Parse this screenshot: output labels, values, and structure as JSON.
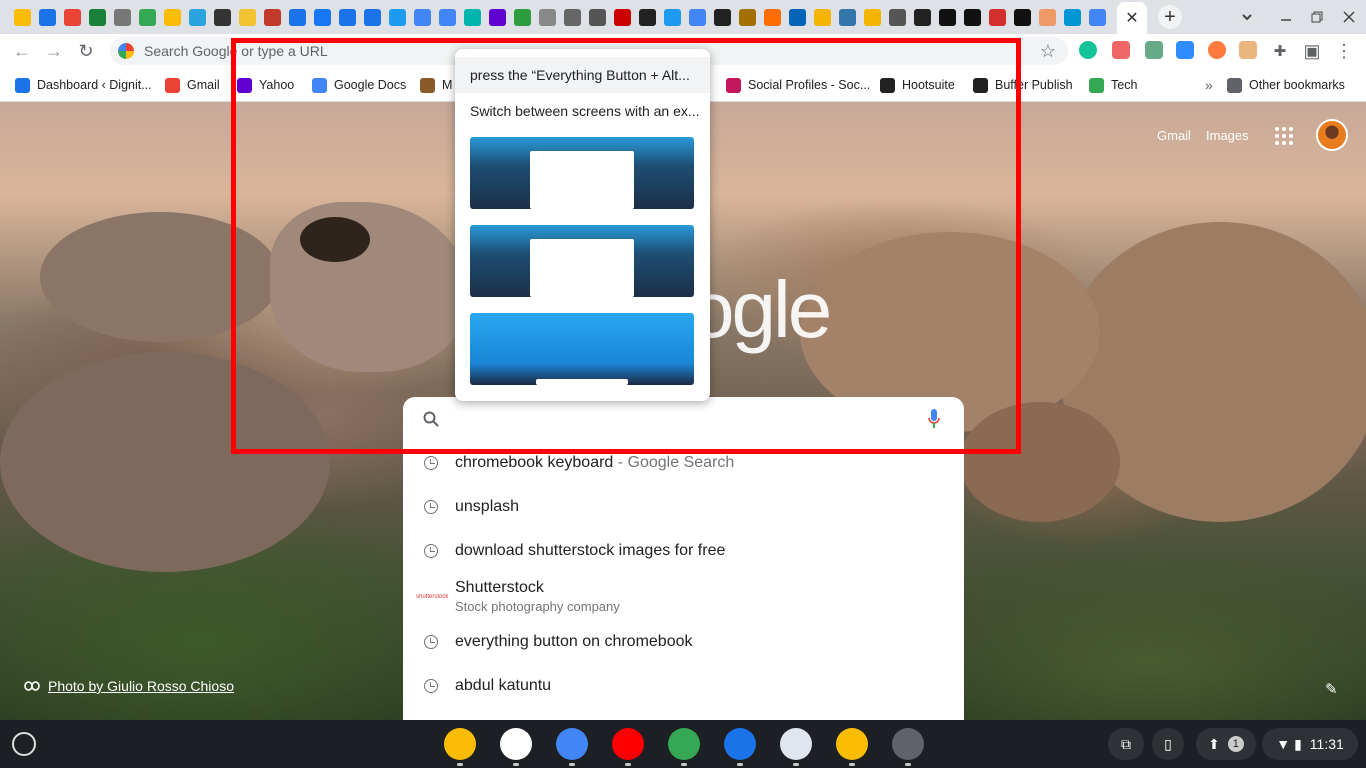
{
  "tabs": {
    "active_close": "✕",
    "new_tab": "+",
    "icons": [
      {
        "name": "chromeos-tab-icon",
        "color": "#fbbc05"
      },
      {
        "name": "docs-tab-icon",
        "color": "#1a73e8"
      },
      {
        "name": "gmail-tab-icon",
        "color": "#ea4335"
      },
      {
        "name": "sheets-tab-icon",
        "color": "#188038"
      },
      {
        "name": "cart-tab-icon",
        "color": "#777"
      },
      {
        "name": "tab-2-icon",
        "color": "#34a853"
      },
      {
        "name": "drive-tab-icon",
        "color": "#fbbc05"
      },
      {
        "name": "telegram-tab-icon",
        "color": "#2aa3df"
      },
      {
        "name": "tab-icon-9",
        "color": "#333"
      },
      {
        "name": "tab-icon-10",
        "color": "#f1c232"
      },
      {
        "name": "tab-icon-11",
        "color": "#c0392b"
      },
      {
        "name": "docs-tab-icon-2",
        "color": "#1a73e8"
      },
      {
        "name": "facebook-tab-icon",
        "color": "#1877f2"
      },
      {
        "name": "tab-icon-14",
        "color": "#1a73e8"
      },
      {
        "name": "tab-icon-15",
        "color": "#1a73e8"
      },
      {
        "name": "twitter-tab-icon",
        "color": "#1d9bf0"
      },
      {
        "name": "docs-tab-icon-3",
        "color": "#4285f4"
      },
      {
        "name": "docs-tab-icon-4",
        "color": "#4285f4"
      },
      {
        "name": "tab-icon-19",
        "color": "#00b5ad"
      },
      {
        "name": "yahoo-mail-tab-icon",
        "color": "#6001d2"
      },
      {
        "name": "px-tab-icon",
        "color": "#2e9d3e"
      },
      {
        "name": "tab-icon-22",
        "color": "#888"
      },
      {
        "name": "tab-icon-23",
        "color": "#666"
      },
      {
        "name": "tab-icon-24",
        "color": "#555"
      },
      {
        "name": "help-tab-icon",
        "color": "#c00"
      },
      {
        "name": "h-tab-icon",
        "color": "#222"
      },
      {
        "name": "twitter-tab-icon-2",
        "color": "#1d9bf0"
      },
      {
        "name": "docs-tab-icon-5",
        "color": "#4285f4"
      },
      {
        "name": "tab-icon-29",
        "color": "#222"
      },
      {
        "name": "tab-icon-30",
        "color": "#a36f00"
      },
      {
        "name": "k-tab-icon",
        "color": "#ff6d00"
      },
      {
        "name": "outlook-tab-icon",
        "color": "#0364b8"
      },
      {
        "name": "slides-tab-icon",
        "color": "#f4b400"
      },
      {
        "name": "tab-icon-34",
        "color": "#37a"
      },
      {
        "name": "slides-tab-icon-2",
        "color": "#f4b400"
      },
      {
        "name": "tab-icon-36",
        "color": "#555"
      },
      {
        "name": "calendar-tab-icon",
        "color": "#222"
      },
      {
        "name": "tab-icon-38",
        "color": "#111"
      },
      {
        "name": "htg-tab-icon",
        "color": "#111"
      },
      {
        "name": "ta-tab-icon",
        "color": "#d32f2f"
      },
      {
        "name": "we-tab-icon",
        "color": "#111"
      },
      {
        "name": "tab-icon-42",
        "color": "#e96"
      },
      {
        "name": "hp-tab-icon",
        "color": "#0096d6"
      },
      {
        "name": "google-tab-icon",
        "color": "#4285f4"
      }
    ]
  },
  "toolbar": {
    "back": "←",
    "forward": "→",
    "reload": "↻",
    "omnibox_placeholder": "Search Google or type a URL",
    "star": "☆"
  },
  "bookmarks": {
    "items": [
      {
        "label": "Dashboard ‹ Dignit...",
        "color": "#1a73e8"
      },
      {
        "label": "Gmail",
        "color": "#ea4335"
      },
      {
        "label": "Yahoo",
        "color": "#6001d2"
      },
      {
        "label": "Google Docs",
        "color": "#4285f4"
      },
      {
        "label": "M",
        "color": "#8b5a2b"
      },
      {
        "label": "Social Profiles - Soc...",
        "color": "#c2185b"
      },
      {
        "label": "Hootsuite",
        "color": "#222"
      },
      {
        "label": "Buffer Publish",
        "color": "#222"
      },
      {
        "label": "Tech",
        "color": "#34a853"
      }
    ],
    "overflow": "»",
    "other": "Other bookmarks"
  },
  "ntp": {
    "gmail": "Gmail",
    "images": "Images",
    "logo_text": "ogle",
    "credit": "Photo by Giulio Rosso Chioso"
  },
  "popup": {
    "item1": "press the “Everything Button + Alt...",
    "item2": "Switch between screens with an ex..."
  },
  "suggestions": [
    {
      "text": "chromebook keyboard",
      "sub": " - Google Search"
    },
    {
      "text": "unsplash"
    },
    {
      "text": "download shutterstock images for free"
    },
    {
      "text": "Shutterstock",
      "sub_line": "Stock photography company",
      "logo": "shutterstock"
    },
    {
      "text": "everything button on chromebook"
    },
    {
      "text": "abdul katuntu"
    }
  ],
  "shelf": {
    "apps": [
      {
        "name": "chrome-app-icon",
        "color": "#fbbc05"
      },
      {
        "name": "gmail-app-icon",
        "color": "#ffffff"
      },
      {
        "name": "docs-app-icon",
        "color": "#4285f4"
      },
      {
        "name": "youtube-app-icon",
        "color": "#ff0000"
      },
      {
        "name": "play-store-app-icon",
        "color": "#34a853"
      },
      {
        "name": "messages-app-icon",
        "color": "#1a73e8"
      },
      {
        "name": "tools-app-icon",
        "color": "#dfe6ee"
      },
      {
        "name": "keep-app-icon",
        "color": "#fbbc04"
      },
      {
        "name": "settings-app-icon",
        "color": "#5f6368"
      }
    ],
    "notification_count": "1",
    "time": "11:31"
  }
}
